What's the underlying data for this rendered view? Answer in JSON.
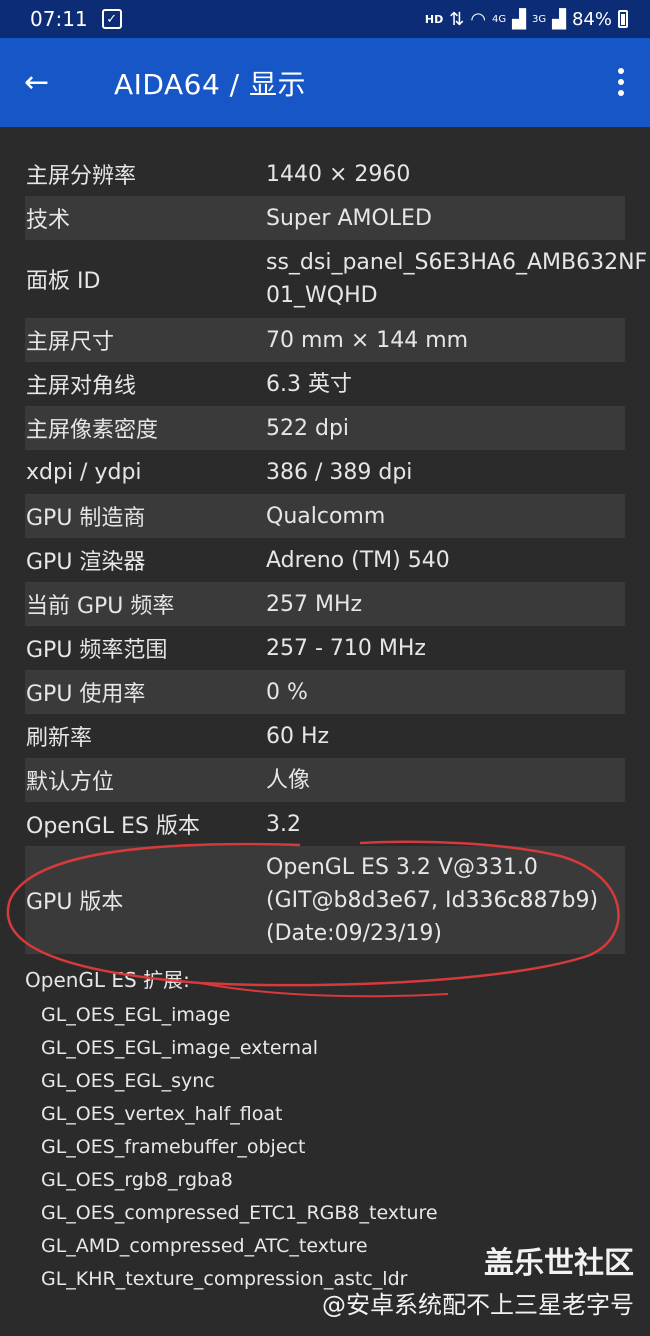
{
  "status_bar": {
    "time": "07:11",
    "hd": "HD",
    "net1": "4G",
    "net2": "3G",
    "battery": "84%"
  },
  "app_bar": {
    "back_icon": "←",
    "title": "AIDA64  /  显示",
    "menu_icon": "more-vert"
  },
  "rows": [
    {
      "label": "主屏分辨率",
      "value": "1440 × 2960"
    },
    {
      "label": "技术",
      "value": "Super AMOLED"
    },
    {
      "label": "面板 ID",
      "value": "ss_dsi_panel_S6E3HA6_AMB632NF",
      "value2": "01_WQHD"
    },
    {
      "label": "主屏尺寸",
      "value": "70 mm × 144 mm"
    },
    {
      "label": "主屏对角线",
      "value": "6.3 英寸"
    },
    {
      "label": "主屏像素密度",
      "value": "522 dpi"
    },
    {
      "label": "xdpi / ydpi",
      "value": "386 / 389 dpi"
    },
    {
      "label": "GPU 制造商",
      "value": "Qualcomm"
    },
    {
      "label": "GPU 渲染器",
      "value": "Adreno (TM) 540"
    },
    {
      "label": "当前 GPU 频率",
      "value": "257 MHz"
    },
    {
      "label": "GPU 频率范围",
      "value": "257 - 710 MHz"
    },
    {
      "label": "GPU 使用率",
      "value": "0 %"
    },
    {
      "label": "刷新率",
      "value": "60 Hz"
    },
    {
      "label": "默认方位",
      "value": "人像"
    },
    {
      "label": "OpenGL ES 版本",
      "value": "3.2"
    },
    {
      "label": "GPU 版本",
      "value": "OpenGL ES 3.2 V@331.0",
      "value2": "(GIT@b8d3e67, Id336c887b9)",
      "value3": "(Date:09/23/19)"
    }
  ],
  "extensions": {
    "header": "OpenGL ES 扩展:",
    "items": [
      "GL_OES_EGL_image",
      "GL_OES_EGL_image_external",
      "GL_OES_EGL_sync",
      "GL_OES_vertex_half_float",
      "GL_OES_framebuffer_object",
      "GL_OES_rgb8_rgba8",
      "GL_OES_compressed_ETC1_RGB8_texture",
      "GL_AMD_compressed_ATC_texture",
      "GL_KHR_texture_compression_astc_ldr"
    ]
  },
  "watermark": {
    "line1": "盖乐世社区",
    "line2": "@安卓系统配不上三星老字号"
  },
  "colors": {
    "status_bar": "#0d2c76",
    "app_bar": "#1756c6",
    "background": "#2b2b2b",
    "alt_row": "#3a3a3a",
    "annotation": "#d63a3a"
  }
}
